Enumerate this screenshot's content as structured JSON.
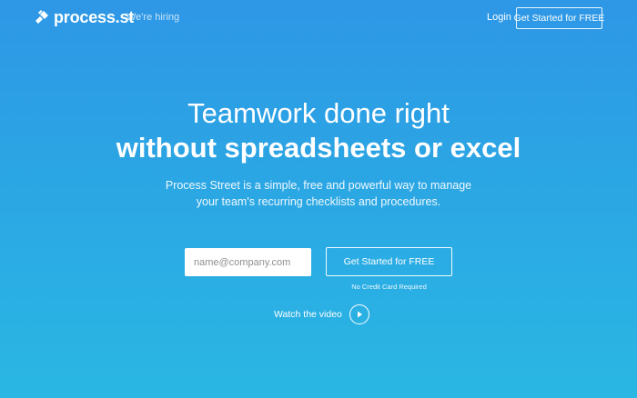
{
  "nav": {
    "brand": "process.st",
    "hiring": "We're hiring",
    "login": "Login",
    "cta": "Get Started for FREE",
    "logo_icon": "process-street-logo-icon"
  },
  "hero": {
    "headline_line1": "Teamwork done right",
    "headline_line2": "without spreadsheets or excel",
    "subtext": "Process Street is a simple, free and powerful way to manage your team's recurring checklists and procedures."
  },
  "signup": {
    "email_placeholder": "name@company.com",
    "email_value": "",
    "cta": "Get Started for FREE",
    "note": "No Credit Card Required"
  },
  "video": {
    "label": "Watch the video",
    "icon": "play-icon"
  },
  "colors": {
    "gradient_top": "#2e97e6",
    "gradient_bottom": "#2ab7e3",
    "text": "#ffffff"
  }
}
